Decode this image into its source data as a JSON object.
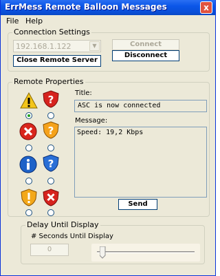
{
  "window": {
    "title": "ErrMess Remote Balloon Messages",
    "close_label": "x"
  },
  "menu": {
    "items": [
      "File",
      "Help"
    ]
  },
  "connection": {
    "group_title": "Connection Settings",
    "host_value": "192.168.1.122",
    "connect_label": "Connect",
    "disconnect_label": "Disconnect",
    "close_server_label": "Close Remote Server"
  },
  "remote": {
    "group_title": "Remote Properties",
    "title_label": "Title:",
    "title_value": "ASC is now connected",
    "message_label": "Message:",
    "message_value": "Speed: 19,2 Kbps",
    "send_label": "Send",
    "icons": [
      {
        "name": "warning-icon",
        "selected": true
      },
      {
        "name": "shield-question-icon",
        "selected": false
      },
      {
        "name": "error-icon",
        "selected": false
      },
      {
        "name": "shield-question-orange-icon",
        "selected": false
      },
      {
        "name": "info-icon",
        "selected": false
      },
      {
        "name": "shield-question-blue-icon",
        "selected": false
      },
      {
        "name": "shield-warning-icon",
        "selected": false
      },
      {
        "name": "shield-error-icon",
        "selected": false
      }
    ]
  },
  "delay": {
    "group_title": "Delay Until Display",
    "seconds_label": "# Seconds Until Display",
    "seconds_value": "0",
    "slider_level": 0
  }
}
